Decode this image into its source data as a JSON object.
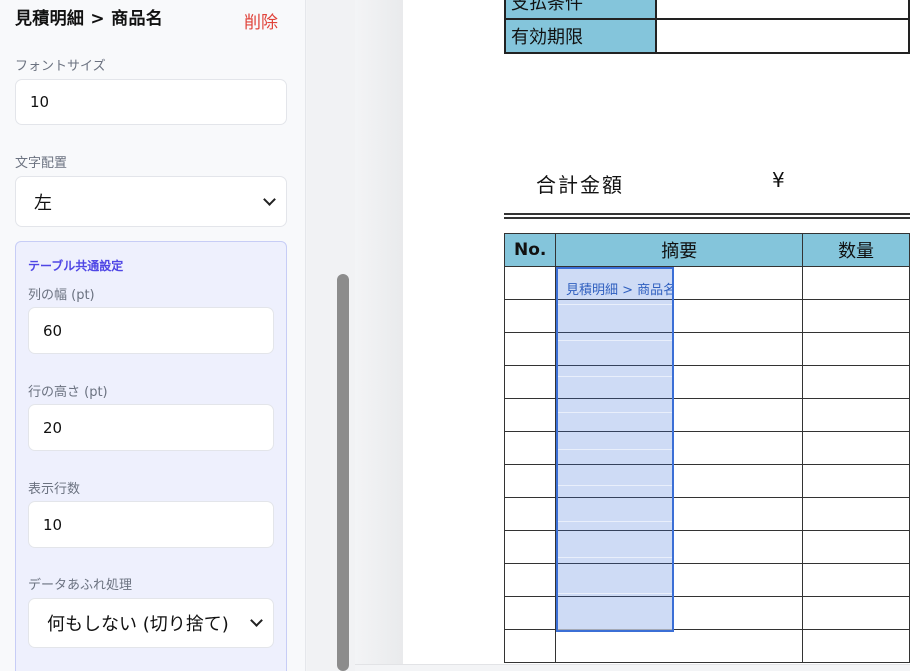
{
  "panel": {
    "title": "見積明細 > 商品名",
    "delete_label": "削除",
    "font_size": {
      "label": "フォントサイズ",
      "value": "10"
    },
    "alignment": {
      "label": "文字配置",
      "value": "左"
    },
    "table_settings": {
      "title": "テーブル共通設定",
      "column_width": {
        "label": "列の幅 (pt)",
        "value": "60"
      },
      "row_height": {
        "label": "行の高さ (pt)",
        "value": "20"
      },
      "display_rows": {
        "label": "表示行数",
        "value": "10"
      },
      "overflow": {
        "label": "データあふれ処理",
        "value": "何もしない (切り捨て)"
      }
    }
  },
  "document": {
    "info_rows": [
      {
        "label": "支払条件",
        "value": ""
      },
      {
        "label": "有効期限",
        "value": ""
      }
    ],
    "total_label": "合計金額",
    "currency_symbol": "¥",
    "table": {
      "headers": [
        "No.",
        "摘要",
        "数量"
      ],
      "row_count": 12
    },
    "selected_column": {
      "label": "見積明細 > 商品名",
      "row_count": 10
    }
  },
  "colors": {
    "header_fill": "#84c5db",
    "selection_border": "#3b6fd6",
    "accent": "#4f46e5",
    "danger": "#e0433a"
  }
}
